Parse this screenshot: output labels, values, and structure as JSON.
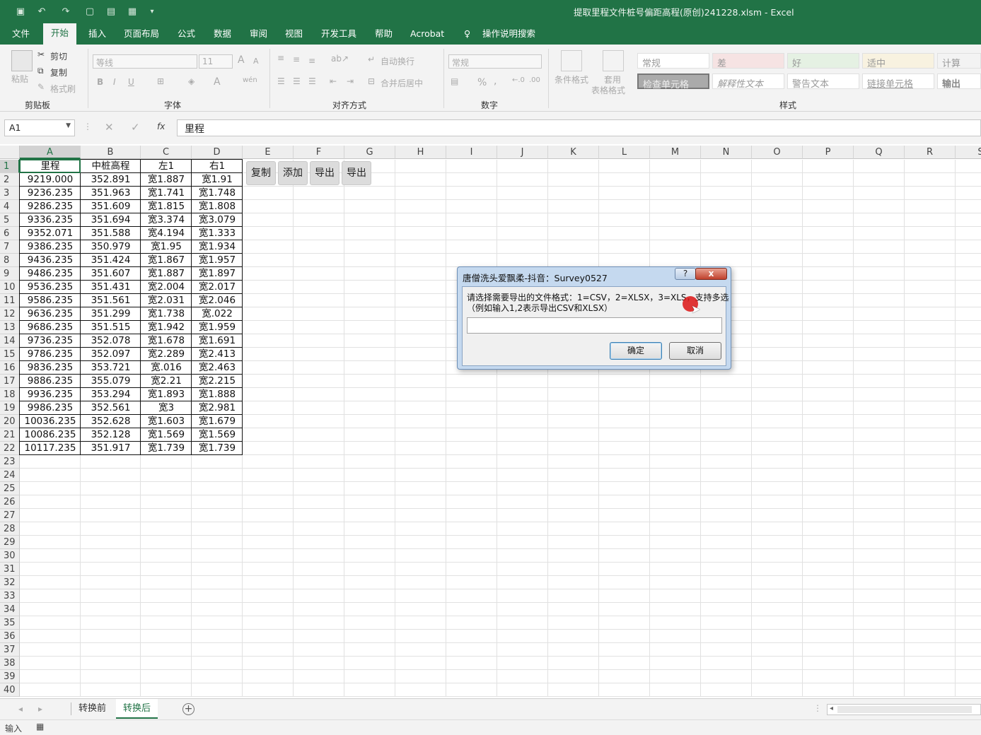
{
  "window": {
    "title": "提取里程文件桩号偏距高程(原创)241228.xlsm  -  Excel"
  },
  "menu": {
    "tabs": [
      "文件",
      "开始",
      "插入",
      "页面布局",
      "公式",
      "数据",
      "审阅",
      "视图",
      "开发工具",
      "帮助",
      "Acrobat"
    ],
    "active": "开始",
    "search": "操作说明搜索"
  },
  "ribbon": {
    "clipboard": {
      "label": "剪贴板",
      "paste": "粘贴",
      "cut": "剪切",
      "copy": "复制",
      "format_painter": "格式刷"
    },
    "font": {
      "label": "字体",
      "font_name": "等线",
      "font_size": "11",
      "bold": "B",
      "italic": "I",
      "underline": "U",
      "grow": "A",
      "shrink": "A",
      "color_a": "A",
      "wen": "wén"
    },
    "alignment": {
      "label": "对齐方式",
      "wrap": "自动换行",
      "merge": "合并后居中"
    },
    "number": {
      "label": "数字",
      "format": "常规",
      "percent": "%",
      "comma": ","
    },
    "styles": {
      "label": "样式",
      "cond_format": "条件格式",
      "table_format_1": "套用",
      "table_format_2": "表格格式",
      "cells": [
        "常规",
        "差",
        "好",
        "适中",
        "计算",
        "检查单元格",
        "解释性文本",
        "警告文本",
        "链接单元格",
        "输出"
      ]
    }
  },
  "formula_bar": {
    "name_box": "A1",
    "fx": "fx",
    "value": "里程"
  },
  "grid": {
    "columns": [
      "A",
      "B",
      "C",
      "D",
      "E",
      "F",
      "G",
      "H",
      "I",
      "J",
      "K",
      "L",
      "M",
      "N",
      "O",
      "P",
      "Q",
      "R",
      "S"
    ],
    "rows": [
      "1",
      "2",
      "3",
      "4",
      "5",
      "6",
      "7",
      "8",
      "9",
      "10",
      "11",
      "12",
      "13",
      "14",
      "15",
      "16",
      "17",
      "18",
      "19",
      "20",
      "21",
      "22",
      "23",
      "24",
      "25",
      "26",
      "27",
      "28",
      "29",
      "30",
      "31",
      "32",
      "33",
      "34",
      "35",
      "36",
      "37",
      "38",
      "39",
      "40"
    ],
    "header": [
      "里程",
      "中桩高程",
      "左1",
      "右1"
    ],
    "data": [
      [
        "9219.000",
        "352.891",
        "宽1.887",
        "宽1.91"
      ],
      [
        "9236.235",
        "351.963",
        "宽1.741",
        "宽1.748"
      ],
      [
        "9286.235",
        "351.609",
        "宽1.815",
        "宽1.808"
      ],
      [
        "9336.235",
        "351.694",
        "宽3.374",
        "宽3.079"
      ],
      [
        "9352.071",
        "351.588",
        "宽4.194",
        "宽1.333"
      ],
      [
        "9386.235",
        "350.979",
        "宽1.95",
        "宽1.934"
      ],
      [
        "9436.235",
        "351.424",
        "宽1.867",
        "宽1.957"
      ],
      [
        "9486.235",
        "351.607",
        "宽1.887",
        "宽1.897"
      ],
      [
        "9536.235",
        "351.431",
        "宽2.004",
        "宽2.017"
      ],
      [
        "9586.235",
        "351.561",
        "宽2.031",
        "宽2.046"
      ],
      [
        "9636.235",
        "351.299",
        "宽1.738",
        "宽.022"
      ],
      [
        "9686.235",
        "351.515",
        "宽1.942",
        "宽1.959"
      ],
      [
        "9736.235",
        "352.078",
        "宽1.678",
        "宽1.691"
      ],
      [
        "9786.235",
        "352.097",
        "宽2.289",
        "宽2.413"
      ],
      [
        "9836.235",
        "353.721",
        "宽.016",
        "宽2.463"
      ],
      [
        "9886.235",
        "355.079",
        "宽2.21",
        "宽2.215"
      ],
      [
        "9936.235",
        "353.294",
        "宽1.893",
        "宽1.888"
      ],
      [
        "9986.235",
        "352.561",
        "宽3",
        "宽2.981"
      ],
      [
        "10036.235",
        "352.628",
        "宽1.603",
        "宽1.679"
      ],
      [
        "10086.235",
        "352.128",
        "宽1.569",
        "宽1.569"
      ],
      [
        "10117.235",
        "351.917",
        "宽1.739",
        "宽1.739"
      ]
    ],
    "sheet_buttons": [
      "复制",
      "添加",
      "导出",
      "导出"
    ]
  },
  "dialog": {
    "title": "唐僧洗头爱飘柔-抖音：Survey0527",
    "help": "?",
    "close": "x",
    "prompt_line1": "请选择需要导出的文件格式：1=CSV，2=XLSX，3=XLS，支持多选",
    "prompt_line2": "（例如输入1,2表示导出CSV和XLSX）",
    "input_value": "",
    "ok": "确定",
    "cancel": "取消"
  },
  "sheet_tabs": {
    "tabs": [
      "转换前",
      "转换后"
    ],
    "active": "转换后",
    "add": "+"
  },
  "status": {
    "mode": "输入"
  }
}
